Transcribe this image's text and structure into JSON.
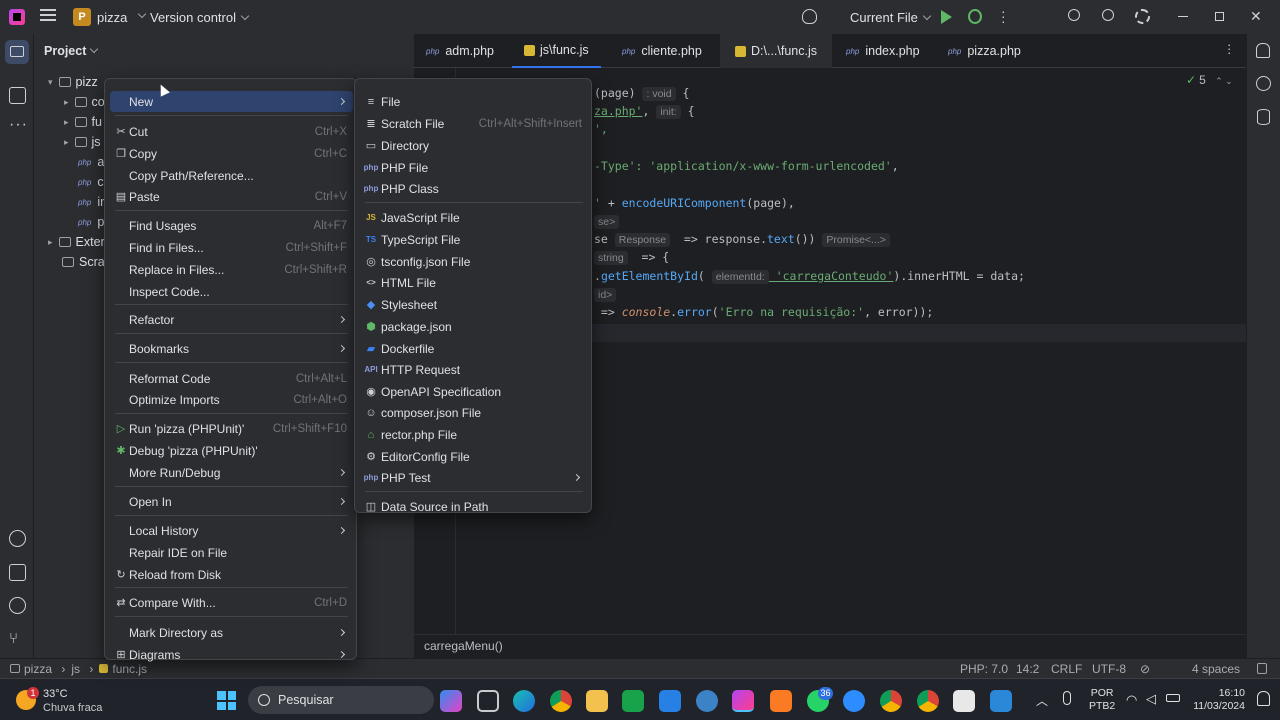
{
  "titlebar": {
    "project_name": "pizza",
    "project_badge": "P",
    "version_control": "Version control",
    "run_config": "Current File"
  },
  "project_panel": {
    "title": "Project",
    "tree": [
      {
        "label": "pizz",
        "type": "folder"
      },
      {
        "label": "co",
        "type": "folder"
      },
      {
        "label": "fu",
        "type": "folder"
      },
      {
        "label": "js",
        "type": "folder"
      },
      {
        "label": "ac",
        "type": "php"
      },
      {
        "label": "cl",
        "type": "php"
      },
      {
        "label": "in",
        "type": "php"
      },
      {
        "label": "pi",
        "type": "php"
      },
      {
        "label": "Exter",
        "type": "library"
      },
      {
        "label": "Scrat",
        "type": "scratch"
      }
    ]
  },
  "tabs": [
    {
      "label": "adm.php",
      "icon": "php"
    },
    {
      "label": "js\\func.js",
      "icon": "js",
      "active": true
    },
    {
      "label": "cliente.php",
      "icon": "php"
    },
    {
      "label": "D:\\...\\func.js",
      "icon": "js"
    },
    {
      "label": "index.php",
      "icon": "php"
    },
    {
      "label": "pizza.php",
      "icon": "php"
    }
  ],
  "editor": {
    "check_count": "5",
    "lines": {
      "l1_a": "(page)",
      "l1_hint": ": void",
      "l1_b": " {",
      "l2_str": "za.php'",
      "l2_b": ", ",
      "l2_hint": "init:",
      "l2_c": " {",
      "l3_str": "',",
      "l5_str": "-Type': 'application/x-www-form-urlencoded'",
      "l5_b": ",",
      "l7_str": "'",
      "l7_b": " + ",
      "l7_fn": "encodeURIComponent",
      "l7_c": "(page),",
      "l8_hint": "se>",
      "l9_a": "se ",
      "l9_hint": "Response",
      "l9_b": "  => response.",
      "l9_fn": "text",
      "l9_c": "()) ",
      "l9_hint2": "Promise<...>",
      "l10_hint": "string",
      "l10_b": "  => {",
      "l11_a": ".",
      "l11_fn": "getElementById",
      "l11_b": "( ",
      "l11_hint": "elementId:",
      "l11_str": " 'carregaConteudo'",
      "l11_c": ").innerHTML = data;",
      "l12_hint": "id>",
      "l13_a": " => ",
      "l13_kw": "console",
      "l13_b": ".",
      "l13_fn": "error",
      "l13_c": "(",
      "l13_str": "'Erro na requisição:'",
      "l13_d": ", error));"
    },
    "breadcrumb": "carregaMenu()"
  },
  "context_menu": [
    {
      "label": "New",
      "submenu": true,
      "highlight": true
    },
    {
      "sep": true
    },
    {
      "label": "Cut",
      "shortcut": "Ctrl+X",
      "icon": "scissors-icon"
    },
    {
      "label": "Copy",
      "shortcut": "Ctrl+C",
      "icon": "copy-icon"
    },
    {
      "label": "Copy Path/Reference..."
    },
    {
      "label": "Paste",
      "shortcut": "Ctrl+V",
      "icon": "paste-icon"
    },
    {
      "sep": true
    },
    {
      "label": "Find Usages",
      "shortcut": "Alt+F7"
    },
    {
      "label": "Find in Files...",
      "shortcut": "Ctrl+Shift+F"
    },
    {
      "label": "Replace in Files...",
      "shortcut": "Ctrl+Shift+R"
    },
    {
      "label": "Inspect Code..."
    },
    {
      "sep": true
    },
    {
      "label": "Refactor",
      "submenu": true
    },
    {
      "sep": true
    },
    {
      "label": "Bookmarks",
      "submenu": true
    },
    {
      "sep": true
    },
    {
      "label": "Reformat Code",
      "shortcut": "Ctrl+Alt+L"
    },
    {
      "label": "Optimize Imports",
      "shortcut": "Ctrl+Alt+O"
    },
    {
      "sep": true
    },
    {
      "label": "Run 'pizza (PHPUnit)'",
      "shortcut": "Ctrl+Shift+F10",
      "icon": "run-icon"
    },
    {
      "label": "Debug 'pizza (PHPUnit)'",
      "icon": "debug-icon"
    },
    {
      "label": "More Run/Debug",
      "submenu": true
    },
    {
      "sep": true
    },
    {
      "label": "Open In",
      "submenu": true
    },
    {
      "sep": true
    },
    {
      "label": "Local History",
      "submenu": true
    },
    {
      "label": "Repair IDE on File"
    },
    {
      "label": "Reload from Disk",
      "icon": "reload-icon"
    },
    {
      "sep": true
    },
    {
      "label": "Compare With...",
      "shortcut": "Ctrl+D",
      "icon": "compare-icon"
    },
    {
      "sep": true
    },
    {
      "label": "Mark Directory as",
      "submenu": true
    },
    {
      "label": "Diagrams",
      "submenu": true,
      "icon": "diagram-icon"
    }
  ],
  "new_submenu": [
    {
      "label": "File",
      "icon": "file-icon"
    },
    {
      "label": "Scratch File",
      "shortcut": "Ctrl+Alt+Shift+Insert",
      "icon": "scratch-icon"
    },
    {
      "label": "Directory",
      "icon": "folder-icon"
    },
    {
      "label": "PHP File",
      "icon": "php-icon"
    },
    {
      "label": "PHP Class",
      "icon": "php-icon"
    },
    {
      "sep": true
    },
    {
      "label": "JavaScript File",
      "icon": "js-icon"
    },
    {
      "label": "TypeScript File",
      "icon": "ts-icon"
    },
    {
      "label": "tsconfig.json File",
      "icon": "tsconfig-icon"
    },
    {
      "label": "HTML File",
      "icon": "html-icon"
    },
    {
      "label": "Stylesheet",
      "icon": "css-icon"
    },
    {
      "label": "package.json",
      "icon": "npm-icon"
    },
    {
      "label": "Dockerfile",
      "icon": "docker-icon"
    },
    {
      "label": "HTTP Request",
      "icon": "api-icon"
    },
    {
      "label": "OpenAPI Specification",
      "icon": "openapi-icon"
    },
    {
      "label": "composer.json File",
      "icon": "composer-icon"
    },
    {
      "label": "rector.php File",
      "icon": "rector-icon"
    },
    {
      "label": "EditorConfig File",
      "icon": "gear-icon"
    },
    {
      "label": "PHP Test",
      "submenu": true,
      "icon": "php-icon"
    },
    {
      "sep": true
    },
    {
      "label": "Data Source in Path",
      "icon": "database-icon"
    }
  ],
  "status_bar": {
    "path": [
      "pizza",
      "js",
      "func.js"
    ],
    "php_version": "PHP: 7.0",
    "position": "14:2",
    "line_sep": "CRLF",
    "encoding": "UTF-8",
    "indent": "4 spaces"
  },
  "taskbar": {
    "weather_temp": "33°C",
    "weather_desc": "Chuva fraca",
    "weather_badge": "1",
    "search_placeholder": "Pesquisar",
    "whatsapp_badge": "36",
    "lang": "POR",
    "layout": "PTB2",
    "time": "16:10",
    "date": "11/03/2024"
  },
  "colors": {
    "accent": "#3574f0",
    "highlight": "#2e436e",
    "string": "#6aab73",
    "keyword": "#cf8e6d",
    "function": "#56a8f5"
  }
}
